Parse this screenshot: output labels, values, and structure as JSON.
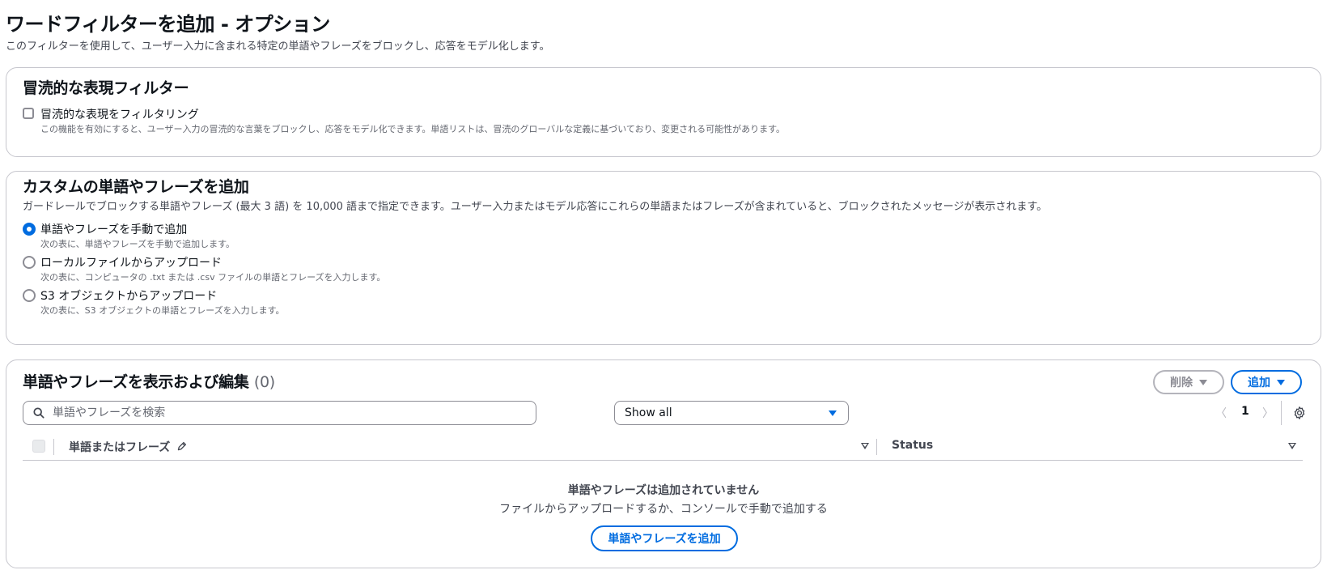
{
  "page": {
    "title": "ワードフィルターを追加 - オプション",
    "description": "このフィルターを使用して、ユーザー入力に含まれる特定の単語やフレーズをブロックし、応答をモデル化します。"
  },
  "profanity": {
    "title": "冒涜的な表現フィルター",
    "checkbox_label": "冒涜的な表現をフィルタリング",
    "checkbox_desc": "この機能を有効にすると、ユーザー入力の冒涜的な言葉をブロックし、応答をモデル化できます。単語リストは、冒涜のグローバルな定義に基づいており、変更される可能性があります。",
    "checked": false
  },
  "custom": {
    "title": "カスタムの単語やフレーズを追加",
    "description": "ガードレールでブロックする単語やフレーズ (最大 3 語) を 10,000 語まで指定できます。ユーザー入力またはモデル応答にこれらの単語またはフレーズが含まれていると、ブロックされたメッセージが表示されます。",
    "options": [
      {
        "label": "単語やフレーズを手動で追加",
        "desc": "次の表に、単語やフレーズを手動で追加します。",
        "selected": true
      },
      {
        "label": "ローカルファイルからアップロード",
        "desc": "次の表に、コンピュータの .txt または .csv ファイルの単語とフレーズを入力します。",
        "selected": false
      },
      {
        "label": "S3 オブジェクトからアップロード",
        "desc": "次の表に、S3 オブジェクトの単語とフレーズを入力します。",
        "selected": false
      }
    ]
  },
  "table": {
    "title": "単語やフレーズを表示および編集",
    "count": "(0)",
    "delete_label": "削除",
    "add_label": "追加",
    "search_placeholder": "単語やフレーズを検索",
    "filter_value": "Show all",
    "page_prev": "〈",
    "page_number": "1",
    "page_next": "〉",
    "columns": [
      "単語またはフレーズ",
      "Status"
    ],
    "empty_title": "単語やフレーズは追加されていません",
    "empty_desc": "ファイルからアップロードするか、コンソールで手動で追加する",
    "empty_button": "単語やフレーズを追加"
  },
  "colors": {
    "accent": "#006ce0",
    "border": "#c6c6cd",
    "text": "#0f141a",
    "muted": "#656871"
  }
}
